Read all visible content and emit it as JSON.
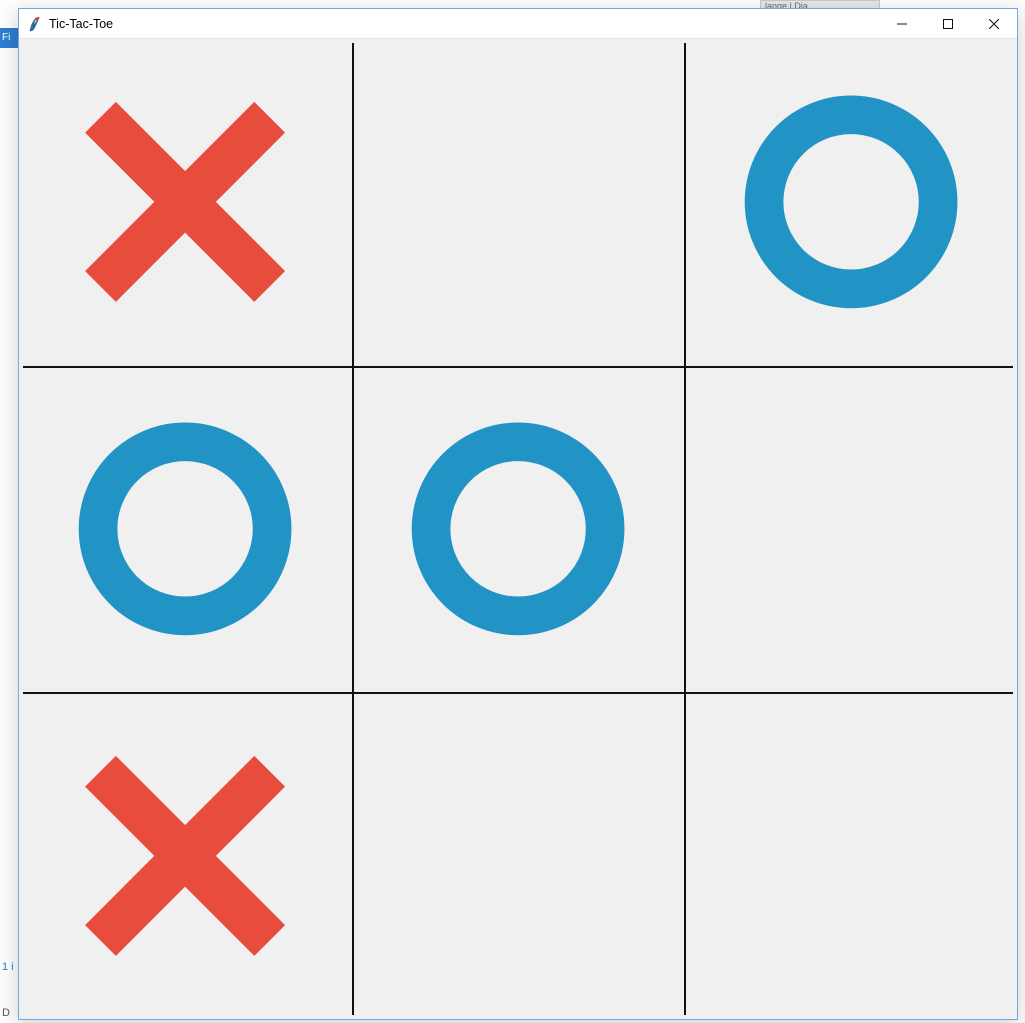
{
  "window": {
    "title": "Tic-Tac-Toe",
    "icon_name": "tk-feather-icon"
  },
  "colors": {
    "x": "#e74c3c",
    "o": "#2193c4",
    "grid": "#111111",
    "canvas_bg": "#f0f0f0"
  },
  "game": {
    "board": [
      [
        "X",
        "",
        "O"
      ],
      [
        "O",
        "O",
        ""
      ],
      [
        "X",
        "",
        ""
      ]
    ],
    "next_turn": "X",
    "rows": 3,
    "cols": 3
  },
  "backdrop": {
    "tab_fragment": "lange | Dia",
    "side_fragment": "Fi",
    "status_fragment": "1 i",
    "bottom_fragment": "D"
  }
}
